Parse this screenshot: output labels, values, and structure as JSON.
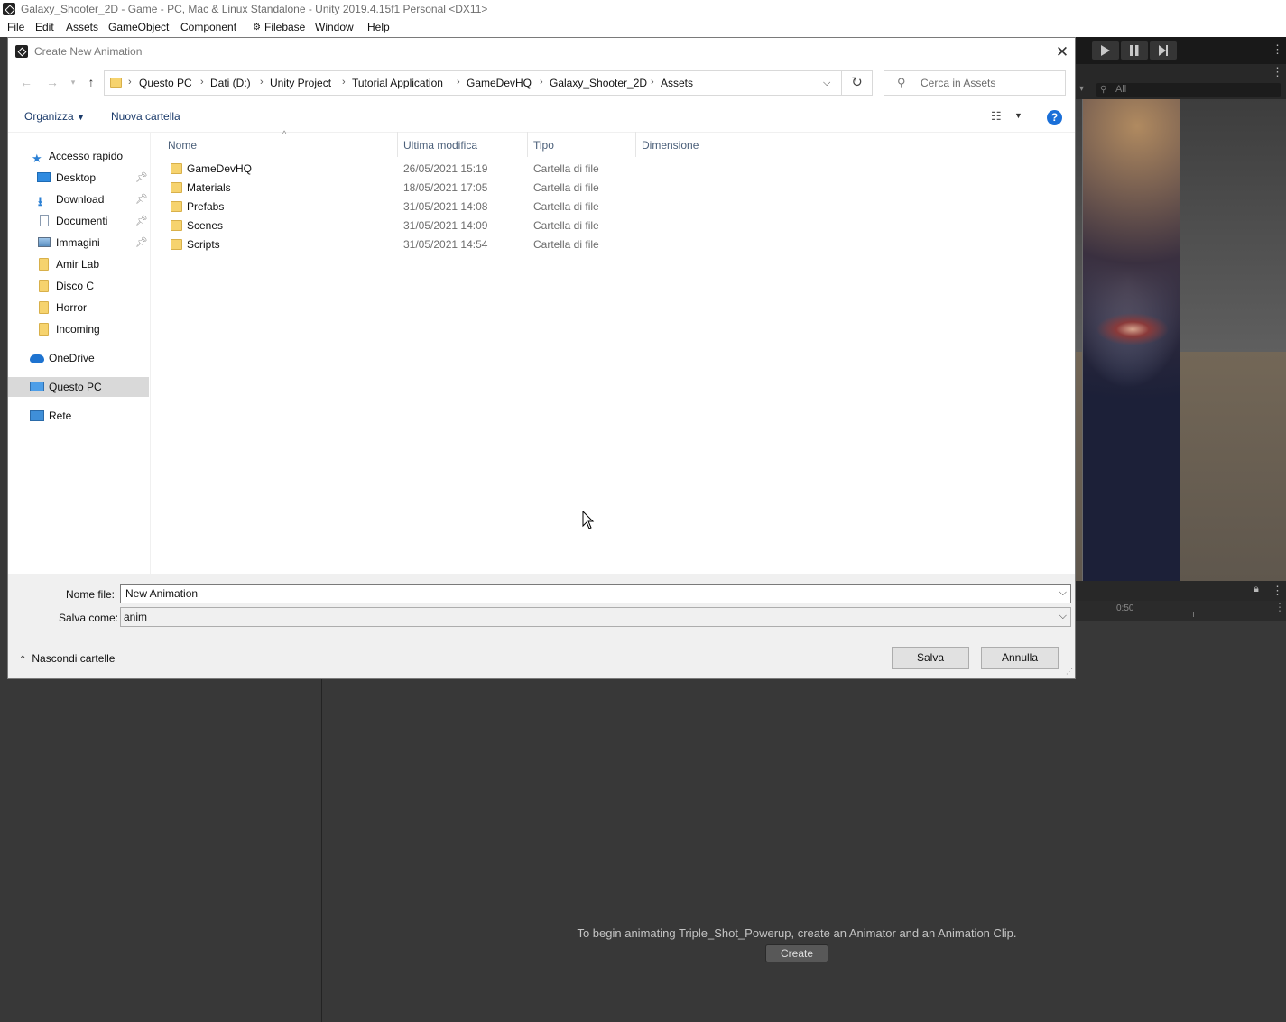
{
  "unity": {
    "title": "Galaxy_Shooter_2D - Game - PC, Mac & Linux Standalone - Unity 2019.4.15f1 Personal <DX11>",
    "menu": [
      "File",
      "Edit",
      "Assets",
      "GameObject",
      "Component",
      "Filebase",
      "Window",
      "Help"
    ],
    "search_placeholder": "All",
    "timeline_tick": "0:50",
    "animation_hint": "To begin animating Triple_Shot_Powerup, create an Animator and an Animation Clip.",
    "create_button": "Create"
  },
  "dialog": {
    "title": "Create New Animation",
    "breadcrumb": [
      "Questo PC",
      "Dati (D:)",
      "Unity Project",
      "Tutorial Application",
      "GameDevHQ",
      "Galaxy_Shooter_2D",
      "Assets"
    ],
    "search_placeholder": "Cerca in Assets",
    "organize": "Organizza",
    "new_folder": "Nuova cartella",
    "nav": {
      "quick_access": "Accesso rapido",
      "items": [
        "Desktop",
        "Download",
        "Documenti",
        "Immagini",
        "Amir Lab",
        "Disco C",
        "Horror",
        "Incoming"
      ],
      "onedrive": "OneDrive",
      "this_pc": "Questo PC",
      "network": "Rete"
    },
    "columns": {
      "name": "Nome",
      "modified": "Ultima modifica",
      "type": "Tipo",
      "size": "Dimensione"
    },
    "files": [
      {
        "name": "GameDevHQ",
        "modified": "26/05/2021 15:19",
        "type": "Cartella di file"
      },
      {
        "name": "Materials",
        "modified": "18/05/2021 17:05",
        "type": "Cartella di file"
      },
      {
        "name": "Prefabs",
        "modified": "31/05/2021 14:08",
        "type": "Cartella di file"
      },
      {
        "name": "Scenes",
        "modified": "31/05/2021 14:09",
        "type": "Cartella di file"
      },
      {
        "name": "Scripts",
        "modified": "31/05/2021 14:54",
        "type": "Cartella di file"
      }
    ],
    "filename_label": "Nome file:",
    "filename_value": "New Animation",
    "saveas_label": "Salva come:",
    "saveas_value": "anim",
    "hide_folders": "Nascondi cartelle",
    "save": "Salva",
    "cancel": "Annulla"
  }
}
